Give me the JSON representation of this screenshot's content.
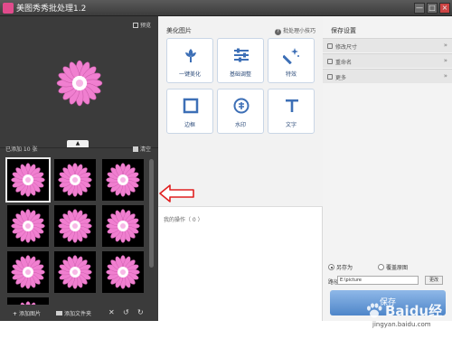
{
  "window": {
    "title": "美图秀秀批处理1.2",
    "buttons": [
      "—",
      "□",
      "×"
    ]
  },
  "left_panel": {
    "preview_label": "预览",
    "added_count_label": "已添加 10 张",
    "clear_label": "清空",
    "collapse_glyph": "▲",
    "bottom": {
      "add_image_label": "添加图片",
      "add_folder_label": "添加文件夹",
      "delete_glyph": "✕",
      "rotate_left_glyph": "↺",
      "rotate_right_glyph": "↻"
    }
  },
  "middle_panel": {
    "title": "美化图片",
    "help_label": "批处理小技巧",
    "tools": [
      {
        "label": "一键美化",
        "icon": "magic-flower-icon"
      },
      {
        "label": "基础调整",
        "icon": "sliders-icon"
      },
      {
        "label": "特效",
        "icon": "magic-wand-icon"
      },
      {
        "label": "边框",
        "icon": "frame-icon"
      },
      {
        "label": "水印",
        "icon": "watermark-icon"
      },
      {
        "label": "文字",
        "icon": "text-icon"
      }
    ],
    "operations_label": "我的操作（ 0 ）"
  },
  "right_panel": {
    "title": "保存设置",
    "sections": [
      {
        "label": "修改尺寸",
        "chevron": "»"
      },
      {
        "label": "重命名",
        "chevron": "»"
      },
      {
        "label": "更多",
        "chevron": "»"
      }
    ],
    "save_as_label": "另存为",
    "overwrite_label": "覆盖原图",
    "path_label": "路径",
    "path_value": "E:\\picture",
    "browse_label": "更改",
    "save_button_label": "保存"
  },
  "watermark": {
    "brand": "Baidu经验",
    "url": "jingyan.baidu.com"
  },
  "colors": {
    "flower_petal": "#f07fd0",
    "flower_center": "#ffffff",
    "arrow": "#e02020",
    "dark_panel": "#3b3b3b",
    "save_button": "#4e86c9"
  }
}
